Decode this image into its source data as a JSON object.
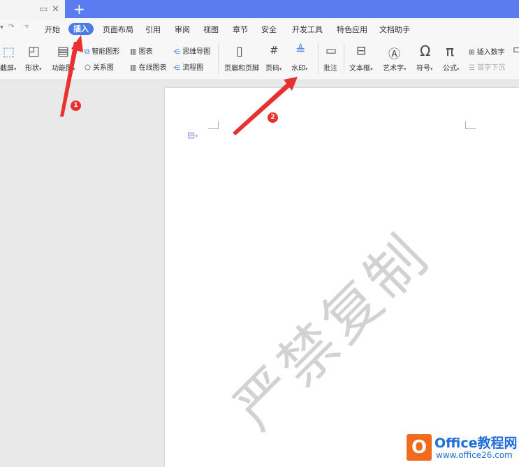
{
  "titlebar": {
    "new_tab_label": "+"
  },
  "quick_access": {
    "redo_glyph": "↷",
    "more_glyph": "▿"
  },
  "menu": {
    "tabs": [
      "开始",
      "插入",
      "页面布局",
      "引用",
      "审阅",
      "视图",
      "章节",
      "安全",
      "开发工具",
      "特色应用",
      "文档助手"
    ],
    "active_tab": "插入"
  },
  "ribbon": {
    "screenshot": "截屏",
    "shape": "形状",
    "function_chart": "功能图",
    "smart_art": "智能图形",
    "chart": "图表",
    "mind_map": "思维导图",
    "relation_chart": "关系图",
    "online_chart": "在线图表",
    "flowchart": "流程图",
    "header_footer": "页眉和页脚",
    "page_number": "页码",
    "watermark": "水印",
    "comment": "批注",
    "text_box": "文本框",
    "word_art": "艺术字",
    "symbol": "符号",
    "formula": "公式",
    "insert_number": "插入数字",
    "drop_cap": "首字下沉"
  },
  "document": {
    "watermark_text": "严禁复制"
  },
  "annotations": {
    "badge_1": "1",
    "badge_2": "2",
    "arrow_color": "#e8322f"
  },
  "logo": {
    "mark": "O",
    "title": "Office教程网",
    "url": "www.office26.com"
  },
  "colors": {
    "accent": "#4a7be8",
    "title_blue": "#5b7cf0",
    "badge_red": "#e8322f",
    "logo_orange": "#f26a1b"
  }
}
